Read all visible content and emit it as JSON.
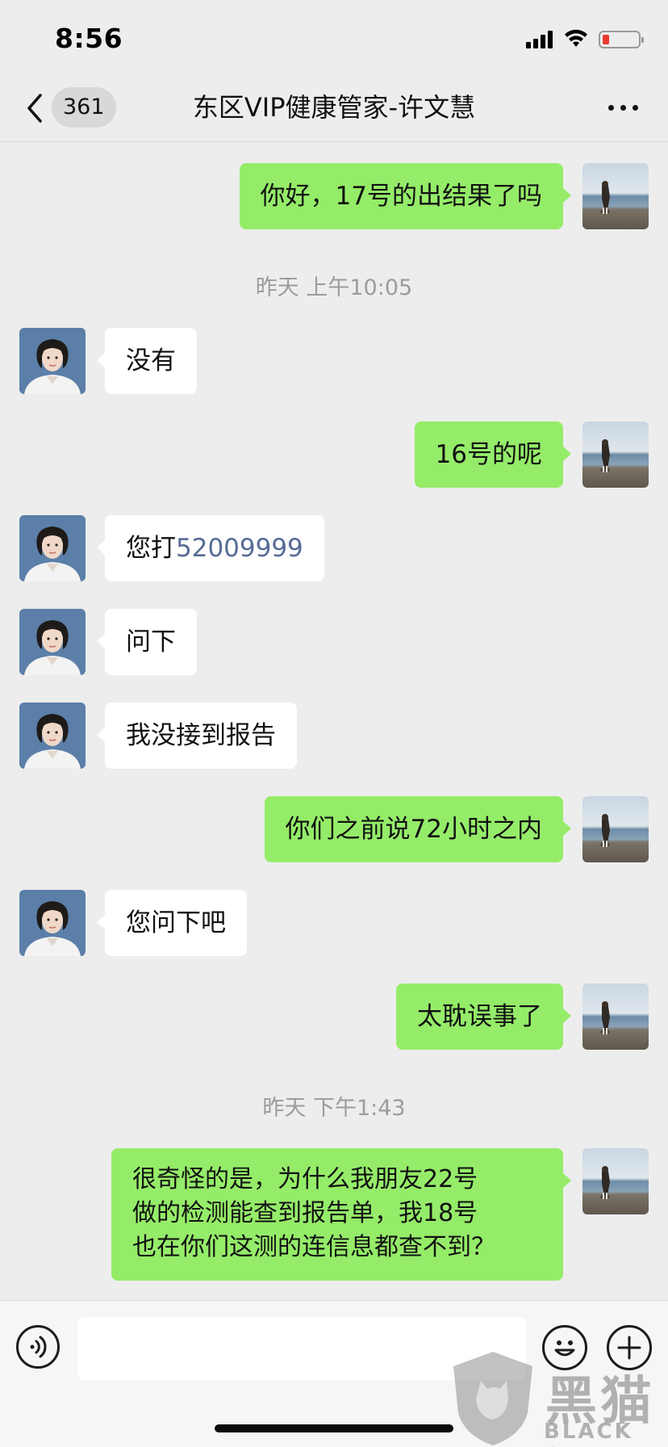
{
  "status_bar": {
    "time": "8:56",
    "battery_color": "#e93b2f"
  },
  "nav": {
    "back_icon": "chevron-left-icon",
    "unread_count": "361",
    "title": "东区VIP健康管家-许文慧",
    "more_icon": "more-dots-icon"
  },
  "messages": {
    "m1": "你好，17号的出结果了吗",
    "t1": "昨天 上午10:05",
    "m2": "没有",
    "m3": "16号的呢",
    "m4_prefix": "您打",
    "m4_phone": "52009999",
    "m5": "问下",
    "m6": "我没接到报告",
    "m7": "你们之前说72小时之内",
    "m8": "您问下吧",
    "m9": "太耽误事了",
    "t2": "昨天 下午1:43",
    "m10_line1": "很奇怪的是，为什么我朋友22号",
    "m10_line2": "做的检测能查到报告单，我18号",
    "m10_line3": "也在你们这测的连信息都查不到？"
  },
  "colors": {
    "sent_bubble": "#95ec69",
    "received_bubble": "#ffffff",
    "phone_link": "#576b95",
    "background": "#ededed"
  },
  "input_bar": {
    "voice_icon": "voice-icon",
    "emoji_icon": "emoji-icon",
    "plus_icon": "plus-icon"
  },
  "watermark": {
    "cn": "黑猫",
    "en": "BLACK CAT"
  }
}
